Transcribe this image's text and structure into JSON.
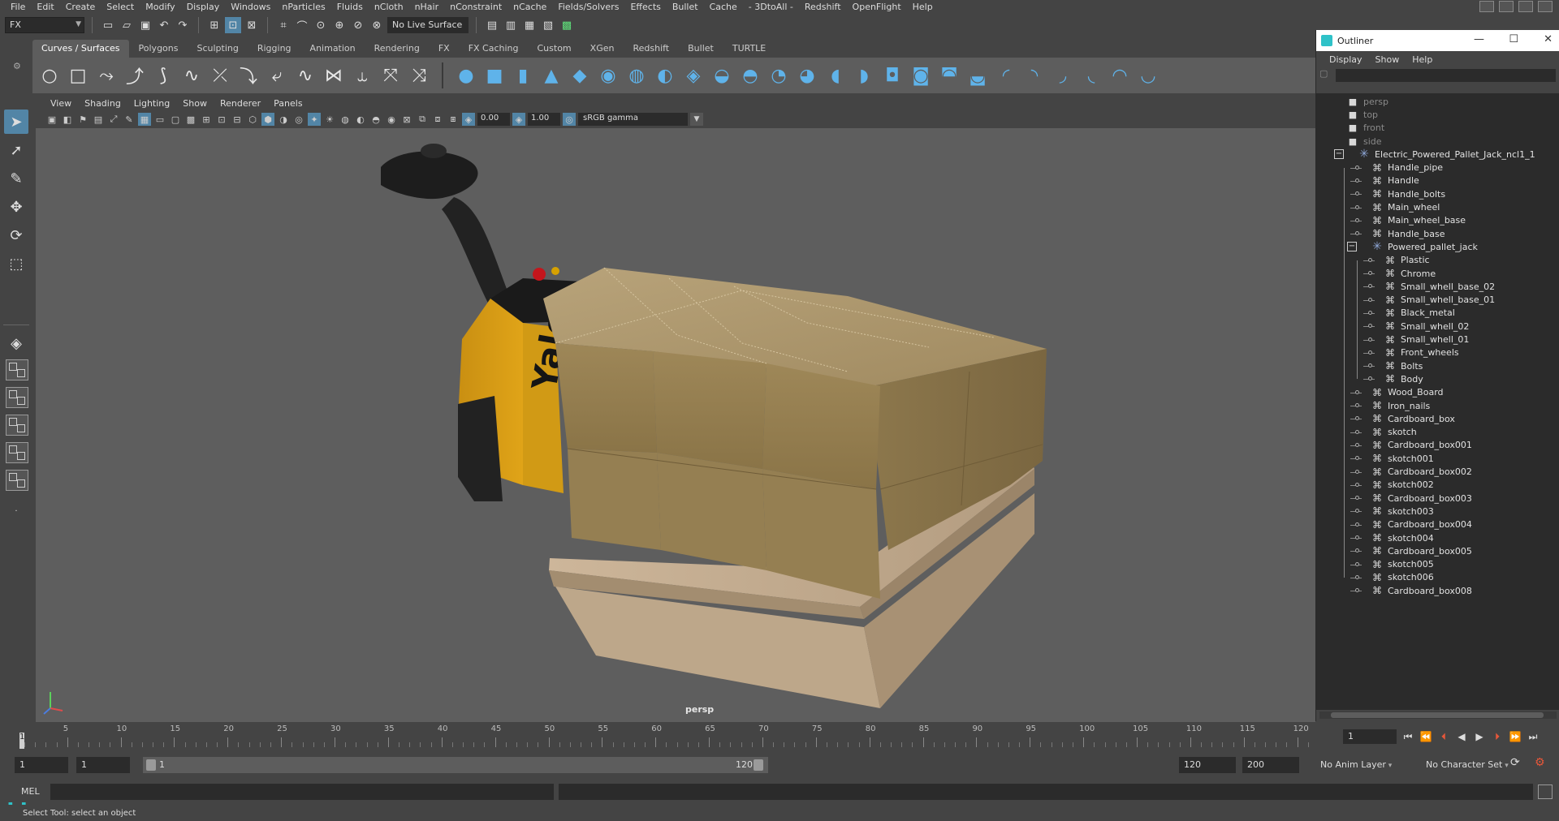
{
  "menus": [
    "File",
    "Edit",
    "Create",
    "Select",
    "Modify",
    "Display",
    "Windows",
    "nParticles",
    "Fluids",
    "nCloth",
    "nHair",
    "nConstraint",
    "nCache",
    "Fields/Solvers",
    "Effects",
    "Bullet",
    "Cache",
    "- 3DtoAll -",
    "Redshift",
    "OpenFlight",
    "Help"
  ],
  "status": {
    "menuset": "FX",
    "live_surface": "No Live Surface"
  },
  "shelf_tabs": [
    "Curves / Surfaces",
    "Polygons",
    "Sculpting",
    "Rigging",
    "Animation",
    "Rendering",
    "FX",
    "FX Caching",
    "Custom",
    "XGen",
    "Redshift",
    "Bullet",
    "TURTLE"
  ],
  "panel_menus": [
    "View",
    "Shading",
    "Lighting",
    "Show",
    "Renderer",
    "Panels"
  ],
  "panel_toolbar": {
    "exposure": "0.00",
    "gamma": "1.00",
    "color_space": "sRGB gamma"
  },
  "viewport": {
    "camera": "persp",
    "brand": "Yale"
  },
  "outliner": {
    "title": "Outliner",
    "menus": [
      "Display",
      "Show",
      "Help"
    ],
    "items": [
      {
        "label": "persp",
        "type": "camera",
        "level": 0,
        "dim": true
      },
      {
        "label": "top",
        "type": "camera",
        "level": 0,
        "dim": true
      },
      {
        "label": "front",
        "type": "camera",
        "level": 0,
        "dim": true
      },
      {
        "label": "side",
        "type": "camera",
        "level": 0,
        "dim": true
      },
      {
        "label": "Electric_Powered_Pallet_Jack_ncl1_1",
        "type": "group",
        "level": 0,
        "expanded": true
      },
      {
        "label": "Handle_pipe",
        "type": "mesh",
        "level": 1
      },
      {
        "label": "Handle",
        "type": "mesh",
        "level": 1
      },
      {
        "label": "Handle_bolts",
        "type": "mesh",
        "level": 1
      },
      {
        "label": "Main_wheel",
        "type": "mesh",
        "level": 1
      },
      {
        "label": "Main_wheel_base",
        "type": "mesh",
        "level": 1
      },
      {
        "label": "Handle_base",
        "type": "mesh",
        "level": 1
      },
      {
        "label": "Powered_pallet_jack",
        "type": "group",
        "level": 1,
        "expanded": true
      },
      {
        "label": "Plastic",
        "type": "mesh",
        "level": 2
      },
      {
        "label": "Chrome",
        "type": "mesh",
        "level": 2
      },
      {
        "label": "Small_whell_base_02",
        "type": "mesh",
        "level": 2
      },
      {
        "label": "Small_whell_base_01",
        "type": "mesh",
        "level": 2
      },
      {
        "label": "Black_metal",
        "type": "mesh",
        "level": 2
      },
      {
        "label": "Small_whell_02",
        "type": "mesh",
        "level": 2
      },
      {
        "label": "Small_whell_01",
        "type": "mesh",
        "level": 2
      },
      {
        "label": "Front_wheels",
        "type": "mesh",
        "level": 2
      },
      {
        "label": "Bolts",
        "type": "mesh",
        "level": 2
      },
      {
        "label": "Body",
        "type": "mesh",
        "level": 2
      },
      {
        "label": "Wood_Board",
        "type": "mesh",
        "level": 1
      },
      {
        "label": "Iron_nails",
        "type": "mesh",
        "level": 1
      },
      {
        "label": "Cardboard_box",
        "type": "mesh",
        "level": 1
      },
      {
        "label": "skotch",
        "type": "mesh",
        "level": 1
      },
      {
        "label": "Cardboard_box001",
        "type": "mesh",
        "level": 1
      },
      {
        "label": "skotch001",
        "type": "mesh",
        "level": 1
      },
      {
        "label": "Cardboard_box002",
        "type": "mesh",
        "level": 1
      },
      {
        "label": "skotch002",
        "type": "mesh",
        "level": 1
      },
      {
        "label": "Cardboard_box003",
        "type": "mesh",
        "level": 1
      },
      {
        "label": "skotch003",
        "type": "mesh",
        "level": 1
      },
      {
        "label": "Cardboard_box004",
        "type": "mesh",
        "level": 1
      },
      {
        "label": "skotch004",
        "type": "mesh",
        "level": 1
      },
      {
        "label": "Cardboard_box005",
        "type": "mesh",
        "level": 1
      },
      {
        "label": "skotch005",
        "type": "mesh",
        "level": 1
      },
      {
        "label": "skotch006",
        "type": "mesh",
        "level": 1
      },
      {
        "label": "Cardboard_box008",
        "type": "mesh",
        "level": 1
      }
    ]
  },
  "timeline": {
    "labels": [
      "5",
      "10",
      "15",
      "20",
      "25",
      "30",
      "35",
      "40",
      "45",
      "50",
      "55",
      "60",
      "65",
      "70",
      "75",
      "80",
      "85",
      "90",
      "95",
      "100",
      "105",
      "110",
      "115",
      "120"
    ],
    "current_frame": "1",
    "current_frame_field": "1"
  },
  "range": {
    "start": "1",
    "playback_start": "1",
    "slider_start": "1",
    "slider_end": "120",
    "playback_end": "120",
    "end": "200",
    "anim_layer": "No Anim Layer",
    "character_set": "No Character Set"
  },
  "cmd": {
    "lang": "MEL"
  },
  "help_line": "Select Tool: select an object"
}
